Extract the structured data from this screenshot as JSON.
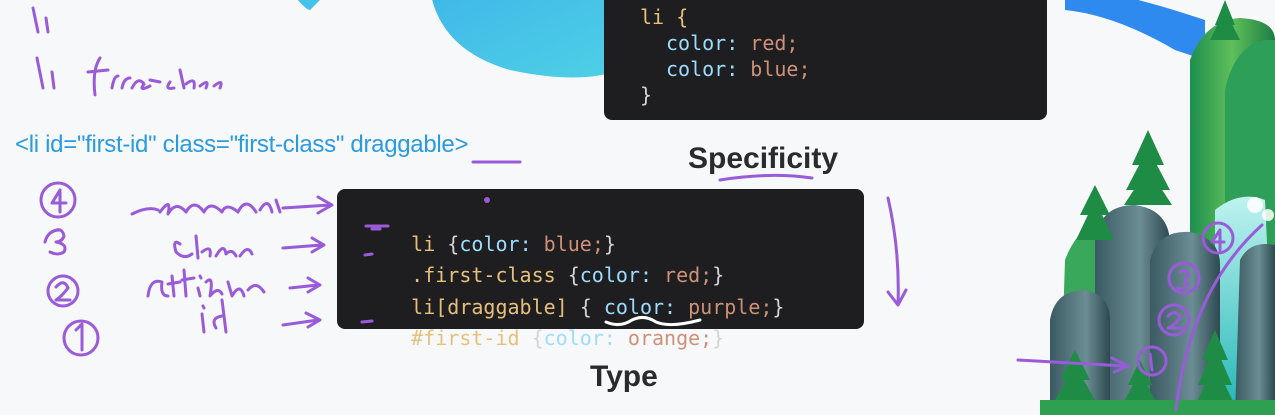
{
  "html_example": "<li id=\"first-id\" class=\"first-class\" draggable>",
  "titles": {
    "specificity": "Specificity",
    "type": "Type"
  },
  "code_top": {
    "selector": "li {",
    "line1_prop": "color:",
    "line1_val": " red;",
    "line2_prop": "color:",
    "line2_val": " blue;",
    "close": "}"
  },
  "code_main": [
    {
      "selector": "li",
      "open": " {",
      "prop": "color:",
      "val": " blue;",
      "close": "}"
    },
    {
      "selector": ".first-class",
      "open": " {",
      "prop": "color:",
      "val": " red;",
      "close": "}"
    },
    {
      "selector": "li[draggable]",
      "open": " { ",
      "prop": "color:",
      "val": " purple;",
      "close": "}"
    },
    {
      "selector": "#first-id",
      "open": " {",
      "prop": "color:",
      "val": " orange;",
      "close": "}"
    }
  ],
  "colors": {
    "accent_purple": "#9a5bd9",
    "html_blue": "#2a9be0",
    "code_bg": "#1e1e20"
  }
}
